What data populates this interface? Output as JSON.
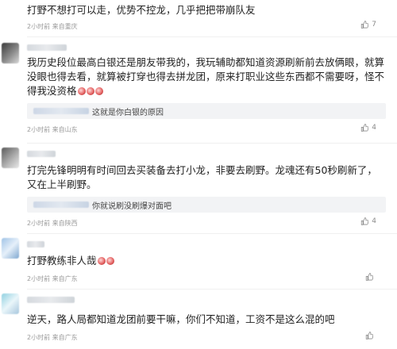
{
  "comments": [
    {
      "text": "打野不想打可以走，优势不控龙，几乎把把带崩队友",
      "meta": "2小时前 来自重庆",
      "likes": "7"
    },
    {
      "text": "我历史段位最高白银还是朋友带我的，我玩辅助都知道资源刷新前去放俩眼，就算没眼也得去看，就算被打穿也得去拼龙团，原来打职业这些东西都不需要呀，怪不得我没资格",
      "reply_text": "这就是你白银的原因",
      "meta": "2小时前 来自山东",
      "likes": "4"
    },
    {
      "text": "打完先锋明明有时间回去买装备去打小龙，非要去刷野。龙魂还有50秒刷新了，又在上半刷野。",
      "reply_text": "你就说刷没刷爆对面吧",
      "meta": "2小时前 来自陕西",
      "likes": "4"
    },
    {
      "text": "打野教练非人哉",
      "meta": "2小时前 来自广东",
      "likes": ""
    },
    {
      "text": "逆天，路人局都知道龙团前要干嘛，你们不知道，工资不是这么混的吧",
      "meta": "2小时前 来自广东",
      "likes": ""
    }
  ],
  "icons": {
    "like": "thumbs-up-icon",
    "emoji": "crying-laughing-emoji-icon"
  },
  "colors": {
    "meta": "#9a9a9a",
    "reply_bg": "#f2f3f5"
  }
}
